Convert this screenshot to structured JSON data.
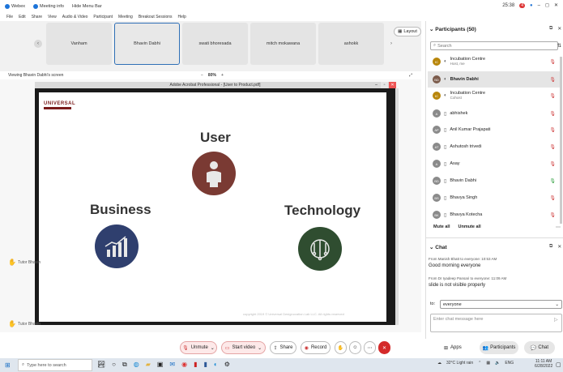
{
  "window": {
    "app": "Webex",
    "meeting_info": "Meeting info",
    "user_menu": "Hide Menu Bar",
    "time": "25:38",
    "rec_badge": "4"
  },
  "menu": [
    "File",
    "Edit",
    "Share",
    "View",
    "Audio & Video",
    "Participant",
    "Meeting",
    "Breakout Sessions",
    "Help"
  ],
  "filmstrip": [
    "Vanham",
    "Bhavin Dabhi",
    "swati bhoresada",
    "mitch mokawana",
    "ashokk"
  ],
  "layout_label": "Layout",
  "share_caption": "Viewing Bhavin Dabhi's screen",
  "zoom": {
    "level": "80%",
    "minus": "−",
    "plus": "+"
  },
  "acrobat_title": "Adobe Acrobat Professional - [User to Product.pdf]",
  "slide": {
    "logo": "UNIVERSAL",
    "center_title": "User",
    "left_title": "Business",
    "right_title": "Technology",
    "footer": "copyright 2019 © Universal Designovation Lab LLC. All rights reserved"
  },
  "side_raises": [
    "Tutor Bhavin",
    "Tutor Bhavin"
  ],
  "controls": {
    "unmute": "Unmute",
    "start_video": "Start video",
    "share": "Share",
    "record": "Record",
    "apps": "Apps",
    "participants": "Participants",
    "chat": "Chat"
  },
  "participants": {
    "title": "Participants (50)",
    "search_placeholder": "Search",
    "list": [
      {
        "initials": "IC",
        "name": "Incubation Centre",
        "sub": "Host, me"
      },
      {
        "initials": "BD",
        "name": "Bhavin Dabhi",
        "sub": ""
      },
      {
        "initials": "IC",
        "name": "Incubation Centre",
        "sub": "Cohost"
      },
      {
        "initials": "A",
        "name": "abhishek",
        "sub": ""
      },
      {
        "initials": "AP",
        "name": "Anil Kumar Prajapati",
        "sub": ""
      },
      {
        "initials": "AT",
        "name": "Ashutosh trivedi",
        "sub": ""
      },
      {
        "initials": "A",
        "name": "Asay",
        "sub": ""
      },
      {
        "initials": "BD",
        "name": "Bhavin Dabhi",
        "sub": ""
      },
      {
        "initials": "BS",
        "name": "Bhavya Singh",
        "sub": ""
      },
      {
        "initials": "BK",
        "name": "Bhavya Kotecha",
        "sub": ""
      }
    ],
    "mute_all": "Mute all",
    "unmute_all": "Unmute all"
  },
  "chat": {
    "title": "Chat",
    "messages": [
      {
        "meta": "From Manish Bhatt to everyone: 10:53 AM",
        "text": "Good morning everyone"
      },
      {
        "meta": "From Dr Iyadeep Pansari to everyone: 11:09 AM",
        "text": "slide is not visible properly"
      }
    ],
    "to_label": "to:",
    "to_value": "everyone",
    "input_placeholder": "Enter chat message here"
  },
  "taskbar": {
    "search": "Type here to search",
    "weather": "32°C Light rain",
    "lang": "ENG",
    "time": "11:11 AM",
    "date": "6/28/2022"
  }
}
